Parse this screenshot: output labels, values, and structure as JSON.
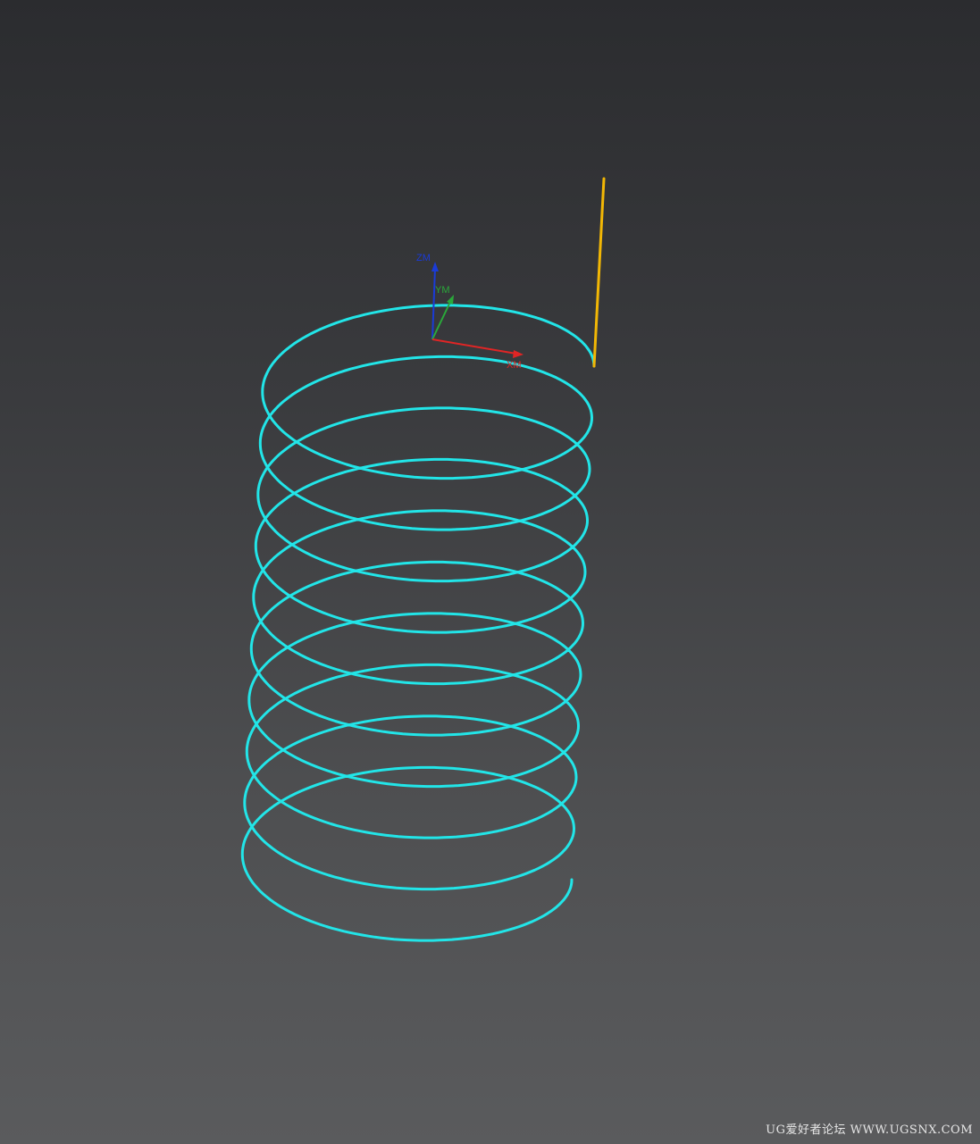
{
  "viewport": {
    "background_top": "#2b2c2f",
    "background_bottom": "#5a5b5d"
  },
  "helix": {
    "color": "#22e5e8",
    "turns": 10
  },
  "lead_line": {
    "color": "#f2b705"
  },
  "csys": {
    "z_label": "ZM",
    "y_label": "YM",
    "x_label": "XM",
    "z_color": "#1a3bd6",
    "y_color": "#2aa83a",
    "x_color": "#e02525"
  },
  "watermark": {
    "text": "UG爱好者论坛 WWW.UGSNX.COM"
  }
}
